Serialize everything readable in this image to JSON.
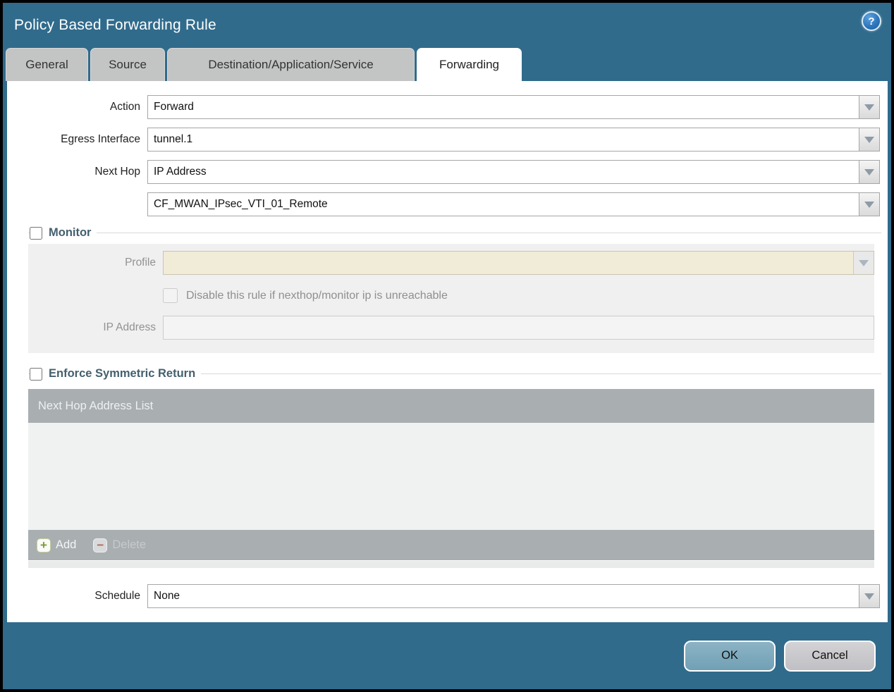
{
  "dialog": {
    "title": "Policy Based Forwarding Rule"
  },
  "icons": {
    "help": "?",
    "plus": "+",
    "minus": "−"
  },
  "tabs": [
    {
      "label": "General",
      "active": false
    },
    {
      "label": "Source",
      "active": false
    },
    {
      "label": "Destination/Application/Service",
      "active": false
    },
    {
      "label": "Forwarding",
      "active": true
    }
  ],
  "form": {
    "action": {
      "label": "Action",
      "value": "Forward"
    },
    "egress_interface": {
      "label": "Egress Interface",
      "value": "tunnel.1"
    },
    "next_hop": {
      "label": "Next Hop",
      "value": "IP Address"
    },
    "next_hop_address": {
      "value": "CF_MWAN_IPsec_VTI_01_Remote"
    },
    "schedule": {
      "label": "Schedule",
      "value": "None"
    }
  },
  "monitor": {
    "title": "Monitor",
    "checked": false,
    "profile_label": "Profile",
    "profile_value": "",
    "disable_label": "Disable this rule if nexthop/monitor ip is unreachable",
    "disable_checked": false,
    "ip_label": "IP Address",
    "ip_value": ""
  },
  "symmetric_return": {
    "title": "Enforce Symmetric Return",
    "checked": false,
    "table_header": "Next Hop Address List",
    "add_label": "Add",
    "delete_label": "Delete"
  },
  "footer": {
    "ok_label": "OK",
    "cancel_label": "Cancel"
  },
  "colors": {
    "titlebar": "#306b8c",
    "active_tab": "#ffffff",
    "inactive_tab": "#c3c4c4",
    "section_title": "#44606e",
    "table_header": "#a9aeb1",
    "table_body": "#f0f1f1",
    "profile_field": "#f1ecd8",
    "ok_button": "#7da9bd",
    "cancel_button": "#cacacd",
    "add_icon_green": "#7e9b3a",
    "delete_icon_red": "#aa6b5c"
  }
}
